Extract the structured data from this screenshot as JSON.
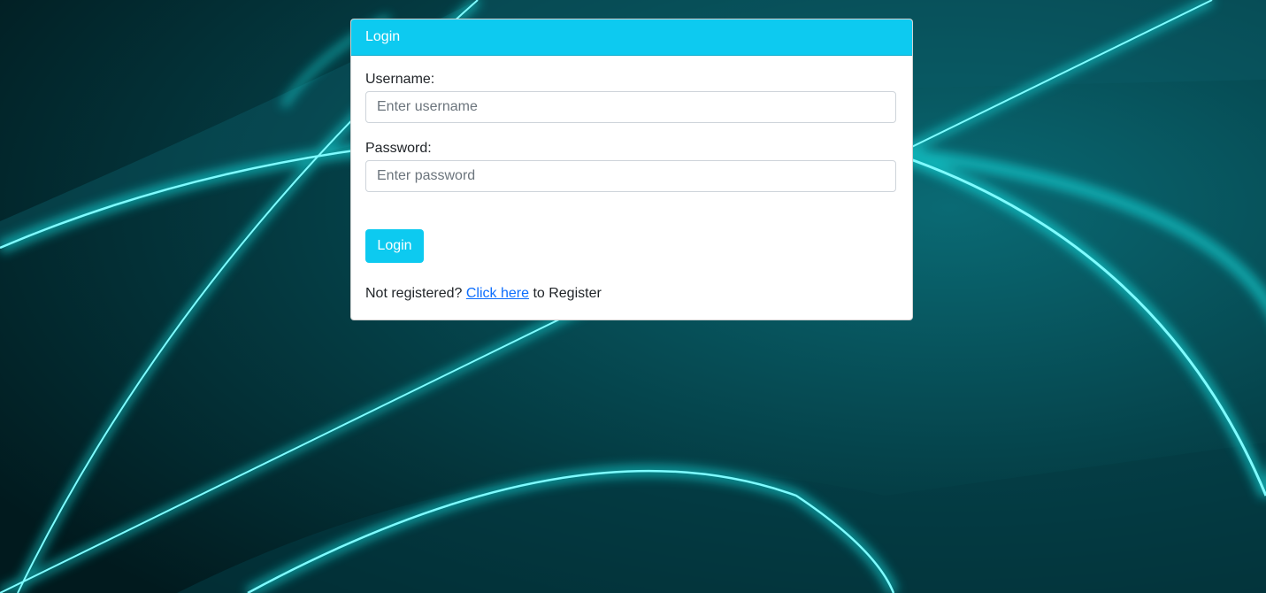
{
  "card": {
    "title": "Login"
  },
  "form": {
    "username_label": "Username:",
    "username_placeholder": "Enter username",
    "username_value": "",
    "password_label": "Password:",
    "password_placeholder": "Enter password",
    "password_value": "",
    "submit_label": "Login"
  },
  "register": {
    "prefix": "Not registered?",
    "link_text": "Click here",
    "suffix": "to Register"
  },
  "colors": {
    "accent": "#0dcaf0",
    "link": "#0d6efd",
    "background_dark": "#022a30",
    "glow": "#19f2f2"
  }
}
